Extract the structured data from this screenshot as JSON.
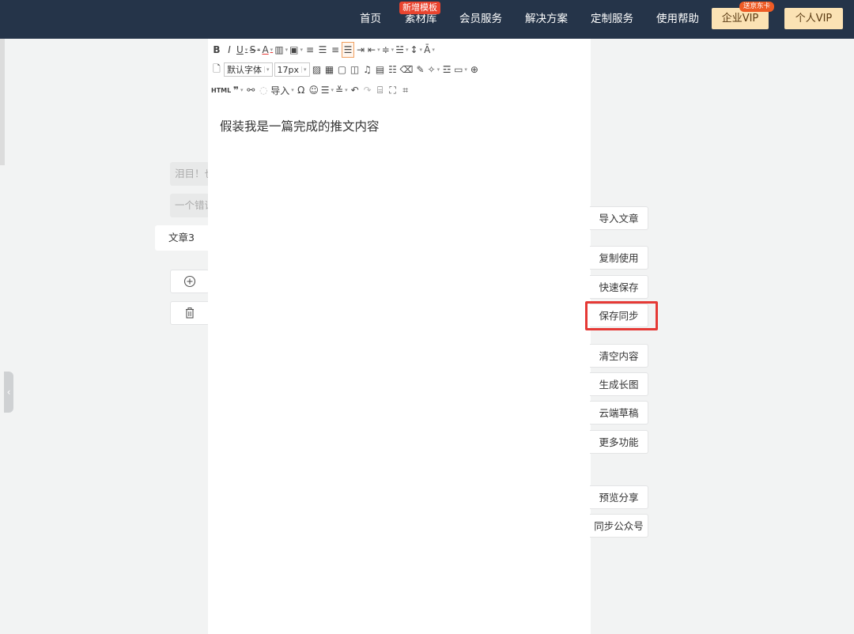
{
  "nav": {
    "items": [
      "首页",
      "素材库",
      "会员服务",
      "解决方案",
      "定制服务",
      "使用帮助"
    ],
    "material_badge": "新增模板",
    "enterprise_vip": "企业VIP",
    "enterprise_badge": "送京东卡",
    "personal_vip": "个人VIP"
  },
  "sidebar": {
    "items": [
      "泪目！也",
      "一个错误"
    ],
    "active_item": "文章3"
  },
  "toolbar": {
    "font_family": "默认字体",
    "font_size": "17px",
    "html_label": "HTML",
    "import_label": "导入"
  },
  "editor": {
    "content": "假装我是一篇完成的推文内容"
  },
  "actions": {
    "import_article": "导入文章",
    "copy_use": "复制使用",
    "quick_save": "快速保存",
    "save_sync": "保存同步",
    "clear_content": "清空内容",
    "generate_long_image": "生成长图",
    "cloud_drafts": "云端草稿",
    "more_features": "更多功能",
    "preview_share": "预览分享",
    "sync_official_account": "同步公众号"
  },
  "colors": {
    "nav_bg": "#253449",
    "vip_bg": "#fbe2b4",
    "badge_red": "#e9442f",
    "highlight_red": "#e53935"
  }
}
